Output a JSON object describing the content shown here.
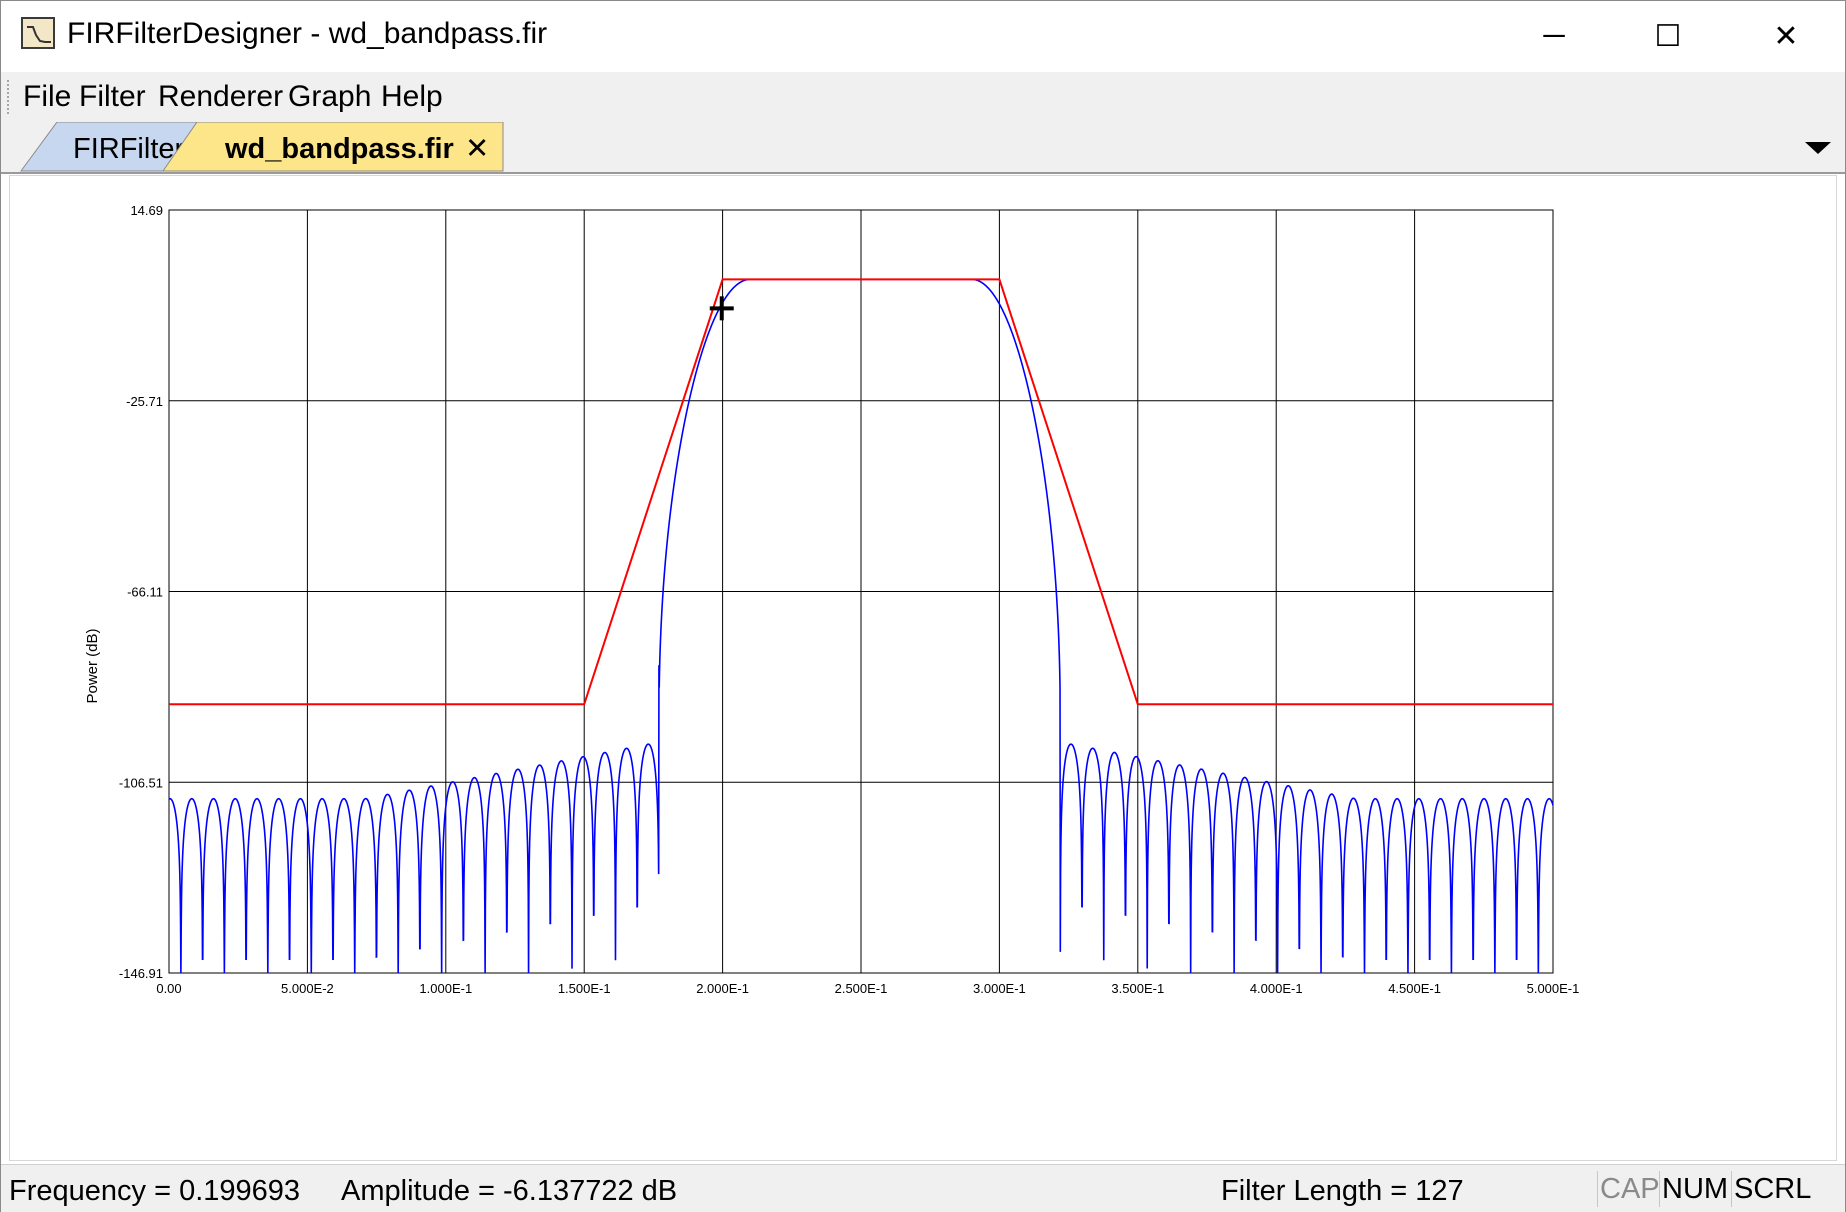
{
  "window": {
    "title": "FIRFilterDesigner - wd_bandpass.fir",
    "minimize": "─",
    "maximize": "☐",
    "close": "✕"
  },
  "menu": {
    "items": [
      "File",
      "Filter",
      "Renderer",
      "Graph",
      "Help"
    ]
  },
  "tabs": [
    {
      "label": "FIRFilter1",
      "active": false
    },
    {
      "label": "wd_bandpass.fir",
      "active": true,
      "close": "✕"
    }
  ],
  "colors": {
    "template_line": "#ff0000",
    "response_line": "#0000ff",
    "active_tab": "#fde68a",
    "inactive_tab": "#c7d7f0"
  },
  "chart_data": {
    "type": "line",
    "title": "",
    "xlabel": "",
    "ylabel": "Power (dB)",
    "xlim": [
      0.0,
      0.5
    ],
    "ylim": [
      -146.91,
      14.69
    ],
    "x_tick_labels": [
      "0.00",
      "5.000E-2",
      "1.000E-1",
      "1.500E-1",
      "2.000E-1",
      "2.500E-1",
      "3.000E-1",
      "3.500E-1",
      "4.000E-1",
      "4.500E-1",
      "5.000E-1"
    ],
    "y_tick_labels": [
      "14.69",
      "-25.71",
      "-66.11",
      "-106.51",
      "-146.91"
    ],
    "grid": true,
    "series": [
      {
        "role": "template",
        "x": [
          0.0,
          0.15,
          0.2,
          0.3,
          0.35,
          0.5
        ],
        "y": [
          -90,
          -90,
          0,
          0,
          -90,
          -90
        ]
      },
      {
        "role": "response",
        "passband": [
          0.2,
          0.3
        ],
        "passband_level": 0,
        "stopband_edges": [
          0.177,
          0.322
        ],
        "sidelobe_peak_near_band": -98,
        "sidelobe_peak_far": -110,
        "sidelobe_period": 0.00785
      }
    ],
    "cursor": {
      "x": 0.199693,
      "y": -6.137722
    }
  },
  "status": {
    "frequency": "Frequency = 0.199693",
    "amplitude": "Amplitude = -6.137722 dB",
    "filter_length": "Filter Length = 127",
    "cap": "CAP",
    "num": "NUM",
    "scrl": "SCRL"
  }
}
